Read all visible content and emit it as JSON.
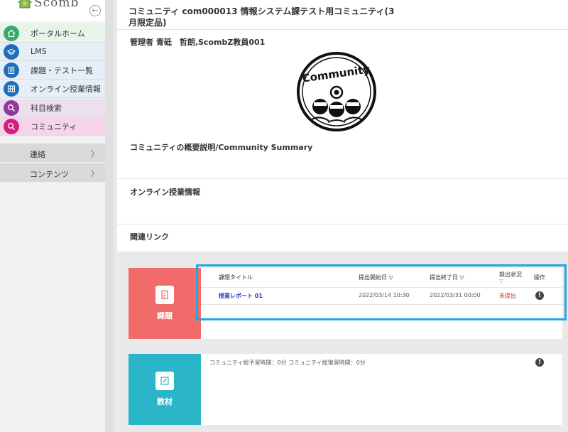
{
  "sidebar": {
    "logo_text": "Scomb",
    "collapse_icon": "arrow-left-icon",
    "nav": [
      {
        "label": "ポータルホーム",
        "icon": "home-icon",
        "color": "#3aa86b",
        "bg": "#e8f4ea"
      },
      {
        "label": "LMS",
        "icon": "graduation-cap-icon",
        "color": "#1e6fb8",
        "bg": "#e6eef8"
      },
      {
        "label": "課題・テスト一覧",
        "icon": "document-icon",
        "color": "#1e6fb8",
        "bg": "#e6eef8"
      },
      {
        "label": "オンライン授業情報",
        "icon": "grid-icon",
        "color": "#1e6fb8",
        "bg": "#e6eef8"
      },
      {
        "label": "科目検索",
        "icon": "search-icon",
        "color": "#8e3a9a",
        "bg": "#ecdff0"
      },
      {
        "label": "コミュニティ",
        "icon": "search-icon",
        "color": "#d61c84",
        "bg": "#f6d5e8"
      }
    ],
    "sub": [
      {
        "label": "連絡",
        "chev": "〉"
      },
      {
        "label": "コンテンツ",
        "chev": "〉"
      }
    ]
  },
  "main": {
    "title": "コミュニティ com000013 情報システム課テスト用コミュニティ(3月限定品)",
    "admin": "管理者 青砥　哲朗,ScombZ教員001",
    "image_label": "Community",
    "summary_label": "コミュニティの概要説明/Community Summary",
    "online_label": "オンライン授業情報",
    "links_label": "関連リンク"
  },
  "tasks": {
    "side_label": "課題",
    "color": "#f26b6b",
    "headers": {
      "title": "課題タイトル",
      "start": "提出開始日 ▽",
      "end": "提出終了日 ▽",
      "status": "提出状況",
      "status_sort": "▽",
      "ops": "操作"
    },
    "rows": [
      {
        "title": "授業レポート 01",
        "start": "2022/03/14 10:30",
        "end": "2022/03/31 00:00",
        "status": "未提出"
      }
    ]
  },
  "materials": {
    "side_label": "教材",
    "color": "#2bb5c8",
    "study_time": "コミュニティ総予習時間：0分 コミュニティ総復習時間：0分"
  },
  "highlight_color": "#1fa8e0"
}
